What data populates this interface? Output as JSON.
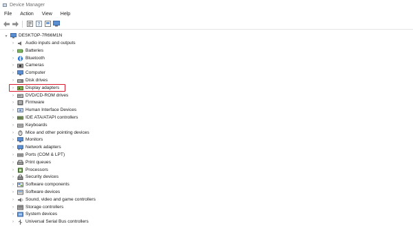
{
  "window": {
    "title": "Device Manager"
  },
  "menu": {
    "items": [
      "File",
      "Action",
      "View",
      "Help"
    ]
  },
  "toolbar": {
    "buttons": [
      "back-icon",
      "forward-icon",
      "properties-icon",
      "help-icon",
      "update-driver-icon",
      "monitor-icon"
    ]
  },
  "tree": {
    "root": "DESKTOP-7R66M1N",
    "items": [
      {
        "label": "Audio inputs and outputs",
        "icon": "audio-icon"
      },
      {
        "label": "Batteries",
        "icon": "battery-icon"
      },
      {
        "label": "Bluetooth",
        "icon": "bluetooth-icon"
      },
      {
        "label": "Cameras",
        "icon": "camera-icon"
      },
      {
        "label": "Computer",
        "icon": "computer-icon"
      },
      {
        "label": "Disk drives",
        "icon": "disk-icon"
      },
      {
        "label": "Display adapters",
        "icon": "display-adapter-icon",
        "highlighted": true
      },
      {
        "label": "DVD/CD-ROM drives",
        "icon": "dvd-icon"
      },
      {
        "label": "Firmware",
        "icon": "firmware-icon"
      },
      {
        "label": "Human Interface Devices",
        "icon": "hid-icon"
      },
      {
        "label": "IDE ATA/ATAPI controllers",
        "icon": "ide-icon"
      },
      {
        "label": "Keyboards",
        "icon": "keyboard-icon"
      },
      {
        "label": "Mice and other pointing devices",
        "icon": "mouse-icon"
      },
      {
        "label": "Monitors",
        "icon": "monitor-icon"
      },
      {
        "label": "Network adapters",
        "icon": "network-icon"
      },
      {
        "label": "Ports (COM & LPT)",
        "icon": "port-icon"
      },
      {
        "label": "Print queues",
        "icon": "printer-icon"
      },
      {
        "label": "Processors",
        "icon": "processor-icon"
      },
      {
        "label": "Security devices",
        "icon": "security-icon"
      },
      {
        "label": "Software components",
        "icon": "software-component-icon"
      },
      {
        "label": "Software devices",
        "icon": "software-device-icon"
      },
      {
        "label": "Sound, video and game controllers",
        "icon": "sound-icon"
      },
      {
        "label": "Storage controllers",
        "icon": "storage-icon"
      },
      {
        "label": "System devices",
        "icon": "system-icon"
      },
      {
        "label": "Universal Serial Bus controllers",
        "icon": "usb-icon"
      }
    ]
  },
  "colors": {
    "highlight": "#d7192b",
    "chevron": "#8a8a8a"
  }
}
